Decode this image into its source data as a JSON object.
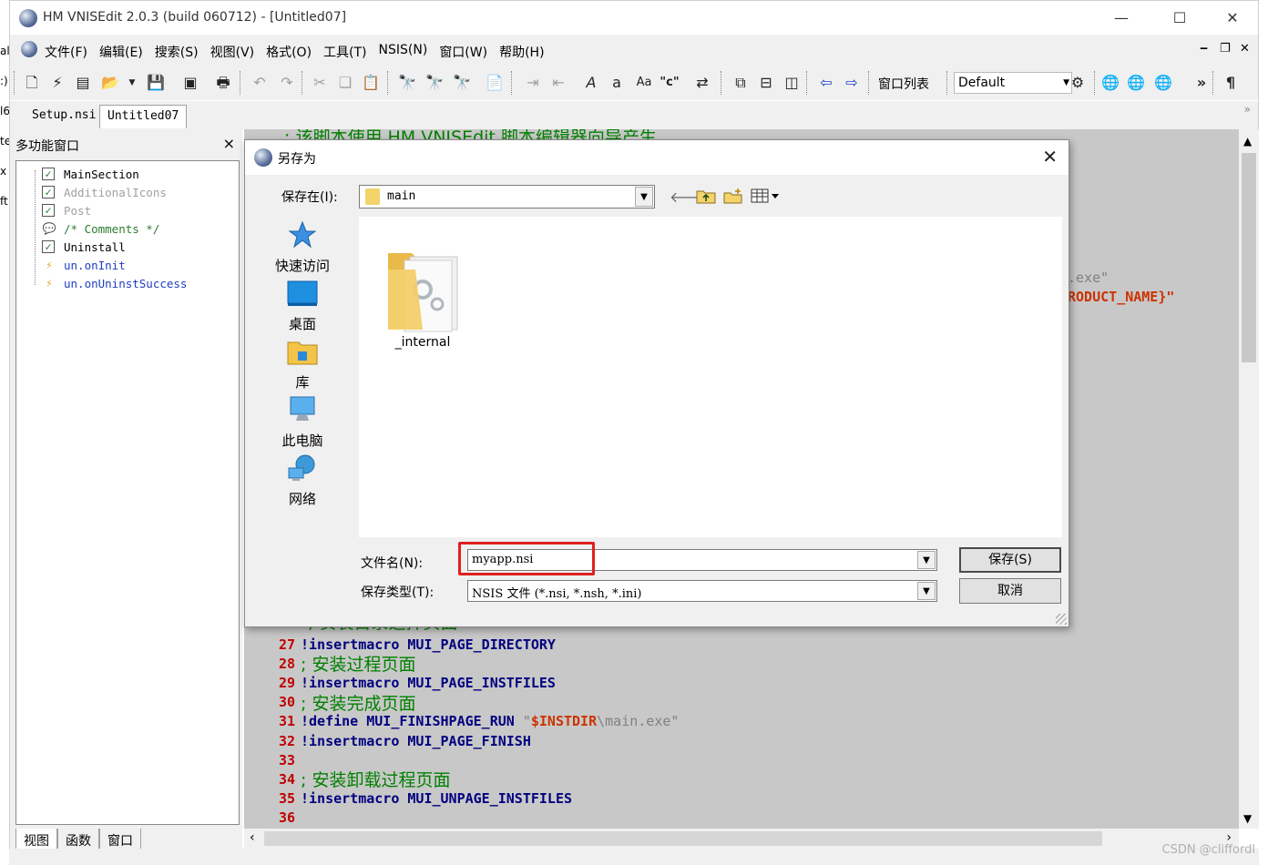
{
  "window": {
    "title": "HM VNISEdit 2.0.3 (build 060712) - [Untitled07]",
    "minimize": "—",
    "maximize": "☐",
    "close": "✕"
  },
  "behind_window_strip": [
    "al",
    ":)",
    "l6",
    "te",
    "x",
    "ft"
  ],
  "menubar": {
    "items": [
      "文件(F)",
      "编辑(E)",
      "搜索(S)",
      "视图(V)",
      "格式(O)",
      "工具(T)",
      "NSIS(N)",
      "窗口(W)",
      "帮助(H)"
    ],
    "mdi_min": "‒",
    "mdi_restore": "❐",
    "mdi_close": "✕"
  },
  "toolbar": {
    "window_list": "窗口列表",
    "profile_select": "Default",
    "overflow": "»",
    "pilcrow": "¶"
  },
  "tabs": [
    "Setup.nsi",
    "Untitled07"
  ],
  "tabs_overflow": "»",
  "sidepanel": {
    "title": "多功能窗口",
    "close": "×",
    "nodes": [
      {
        "label": "MainSection",
        "kind": "checkbox",
        "checked": true,
        "color": "#000000"
      },
      {
        "label": "AdditionalIcons",
        "kind": "checkbox",
        "checked": true,
        "color": "#a0a0a0"
      },
      {
        "label": "Post",
        "kind": "checkbox",
        "checked": true,
        "color": "#a0a0a0"
      },
      {
        "label": "/* Comments */",
        "kind": "comment",
        "color": "#2d7d2d"
      },
      {
        "label": "Uninstall",
        "kind": "checkbox",
        "checked": true,
        "color": "#000000"
      },
      {
        "label": "un.onInit",
        "kind": "function",
        "color": "#1e3fbf"
      },
      {
        "label": "un.onUninstSuccess",
        "kind": "function",
        "color": "#1e3fbf"
      }
    ],
    "bottom_tabs": [
      "视图",
      "函数",
      "窗口"
    ]
  },
  "editor": {
    "partial_top_comment": "; 该脚本使用 HM VNISEdit 脚本编辑器向导产生",
    "partial_right_1": ".exe\"",
    "partial_right_2": "RODUCT_NAME}\"",
    "partial_line_26": "; 安装目录选择页面",
    "lines": [
      {
        "num": "27",
        "parts": [
          {
            "t": "!insertmacro",
            "c": "kw"
          },
          {
            "t": " MUI_PAGE_DIRECTORY",
            "c": "kw"
          }
        ]
      },
      {
        "num": "28",
        "parts": [
          {
            "t": "; 安装过程页面",
            "c": "cm-big"
          }
        ]
      },
      {
        "num": "29",
        "parts": [
          {
            "t": "!insertmacro",
            "c": "kw"
          },
          {
            "t": " MUI_PAGE_INSTFILES",
            "c": "kw"
          }
        ]
      },
      {
        "num": "30",
        "parts": [
          {
            "t": "; 安装完成页面",
            "c": "cm-big"
          }
        ]
      },
      {
        "num": "31",
        "parts": [
          {
            "t": "!define",
            "c": "kw"
          },
          {
            "t": " MUI_FINISHPAGE_RUN ",
            "c": "kw"
          },
          {
            "t": "\"",
            "c": "str"
          },
          {
            "t": "$INSTDIR",
            "c": "var"
          },
          {
            "t": "\\main.exe\"",
            "c": "str"
          }
        ]
      },
      {
        "num": "32",
        "parts": [
          {
            "t": "!insertmacro",
            "c": "kw"
          },
          {
            "t": " MUI_PAGE_FINISH",
            "c": "kw"
          }
        ]
      },
      {
        "num": "33",
        "parts": []
      },
      {
        "num": "34",
        "parts": [
          {
            "t": "; 安装卸载过程页面",
            "c": "cm-big"
          }
        ]
      },
      {
        "num": "35",
        "parts": [
          {
            "t": "!insertmacro",
            "c": "kw"
          },
          {
            "t": " MUI_UNPAGE_INSTFILES",
            "c": "kw"
          }
        ]
      },
      {
        "num": "36",
        "parts": []
      }
    ]
  },
  "dialog": {
    "title": "另存为",
    "close": "✕",
    "save_in_label": "保存在(I):",
    "save_in_value": "main",
    "places": [
      "快速访问",
      "桌面",
      "库",
      "此电脑",
      "网络"
    ],
    "files": [
      {
        "name": "_internal",
        "type": "folder"
      }
    ],
    "filename_label": "文件名(N):",
    "filename_value": "myapp.nsi",
    "filetype_label": "保存类型(T):",
    "filetype_value": "NSIS 文件 (*.nsi, *.nsh, *.ini)",
    "save_button": "保存(S)",
    "cancel_button": "取消"
  },
  "watermark": "CSDN @cliffordl",
  "colors": {
    "editor_bg": "#c8c8c8",
    "keyword": "#000080",
    "comment": "#008000",
    "line_number": "#c00000",
    "highlight_box": "#e02020"
  }
}
